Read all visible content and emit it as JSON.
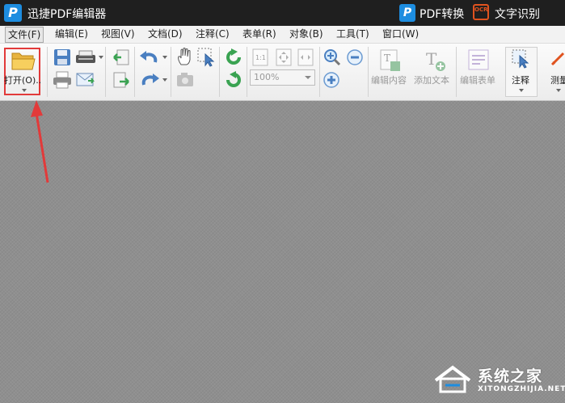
{
  "titlebar": {
    "app_title": "迅捷PDF编辑器",
    "pdf_convert_label": "PDF转换",
    "ocr_icon_text": "OCR",
    "ocr_label": "文字识别",
    "logo_letter": "P"
  },
  "menu": {
    "items": [
      "文件(F)",
      "编辑(E)",
      "视图(V)",
      "文档(D)",
      "注释(C)",
      "表单(R)",
      "对象(B)",
      "工具(T)",
      "窗口(W)"
    ]
  },
  "toolbar": {
    "open_label": "打开(O)..",
    "zoom_value": "100%",
    "edit_content_label": "编辑内容",
    "add_text_label": "添加文本",
    "edit_form_label": "编辑表单",
    "annotate_label": "注释",
    "measure_label": "测量",
    "page_fit_label": "1:1"
  },
  "watermark": {
    "text": "系统之家",
    "sub": "XITONGZHIJIA.NET"
  },
  "colors": {
    "titlebar_bg": "#1f1f1f",
    "brand_blue": "#1d8de0",
    "highlight_red": "#e23a3a",
    "workspace_bg": "#8f8f8f"
  },
  "icons": [
    "open-folder-icon",
    "save-icon",
    "print-icon",
    "scanner-icon",
    "email-icon",
    "extract-page-icon",
    "insert-page-icon",
    "undo-icon",
    "redo-icon",
    "hand-tool-icon",
    "select-tool-icon",
    "snapshot-icon",
    "rotate-left-icon",
    "rotate-right-icon",
    "actual-size-icon",
    "fit-page-icon",
    "fit-width-icon",
    "zoom-in-icon",
    "zoom-out-icon",
    "zoom-tool-icon",
    "edit-content-icon",
    "add-text-icon",
    "edit-form-icon",
    "annotate-icon",
    "measure-icon"
  ]
}
